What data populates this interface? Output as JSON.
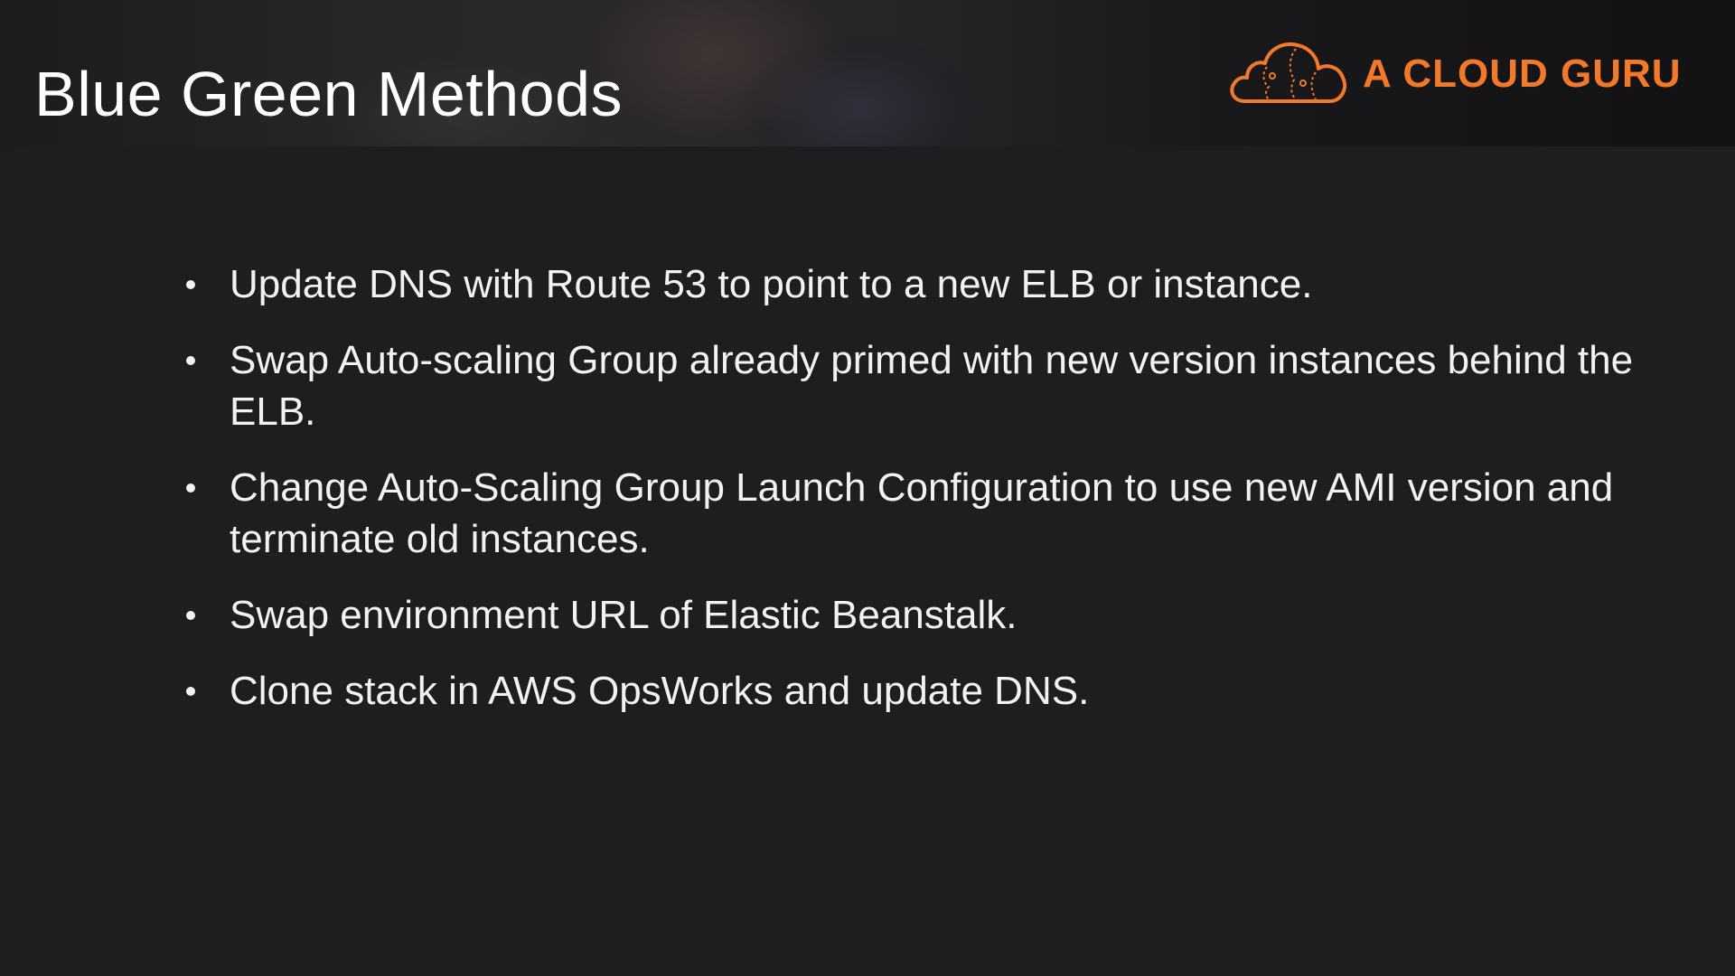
{
  "slide": {
    "title": "Blue Green Methods",
    "brand": {
      "name": "A CLOUD GURU",
      "logo_icon": "cloud-icon",
      "color": "#f0792a"
    },
    "bullets": [
      {
        "text": "Update DNS with Route 53 to point to a new ELB or instance."
      },
      {
        "text": "Swap Auto-scaling Group already primed with new version instances behind the ELB."
      },
      {
        "text": "Change Auto-Scaling Group Launch Configuration to use new AMI version and terminate old instances."
      },
      {
        "text": "Swap environment URL of Elastic Beanstalk."
      },
      {
        "text": "Clone stack in AWS OpsWorks and update DNS."
      }
    ]
  },
  "colors": {
    "background": "#1e1d20",
    "text": "#f2f2f2",
    "accent": "#f0792a"
  }
}
